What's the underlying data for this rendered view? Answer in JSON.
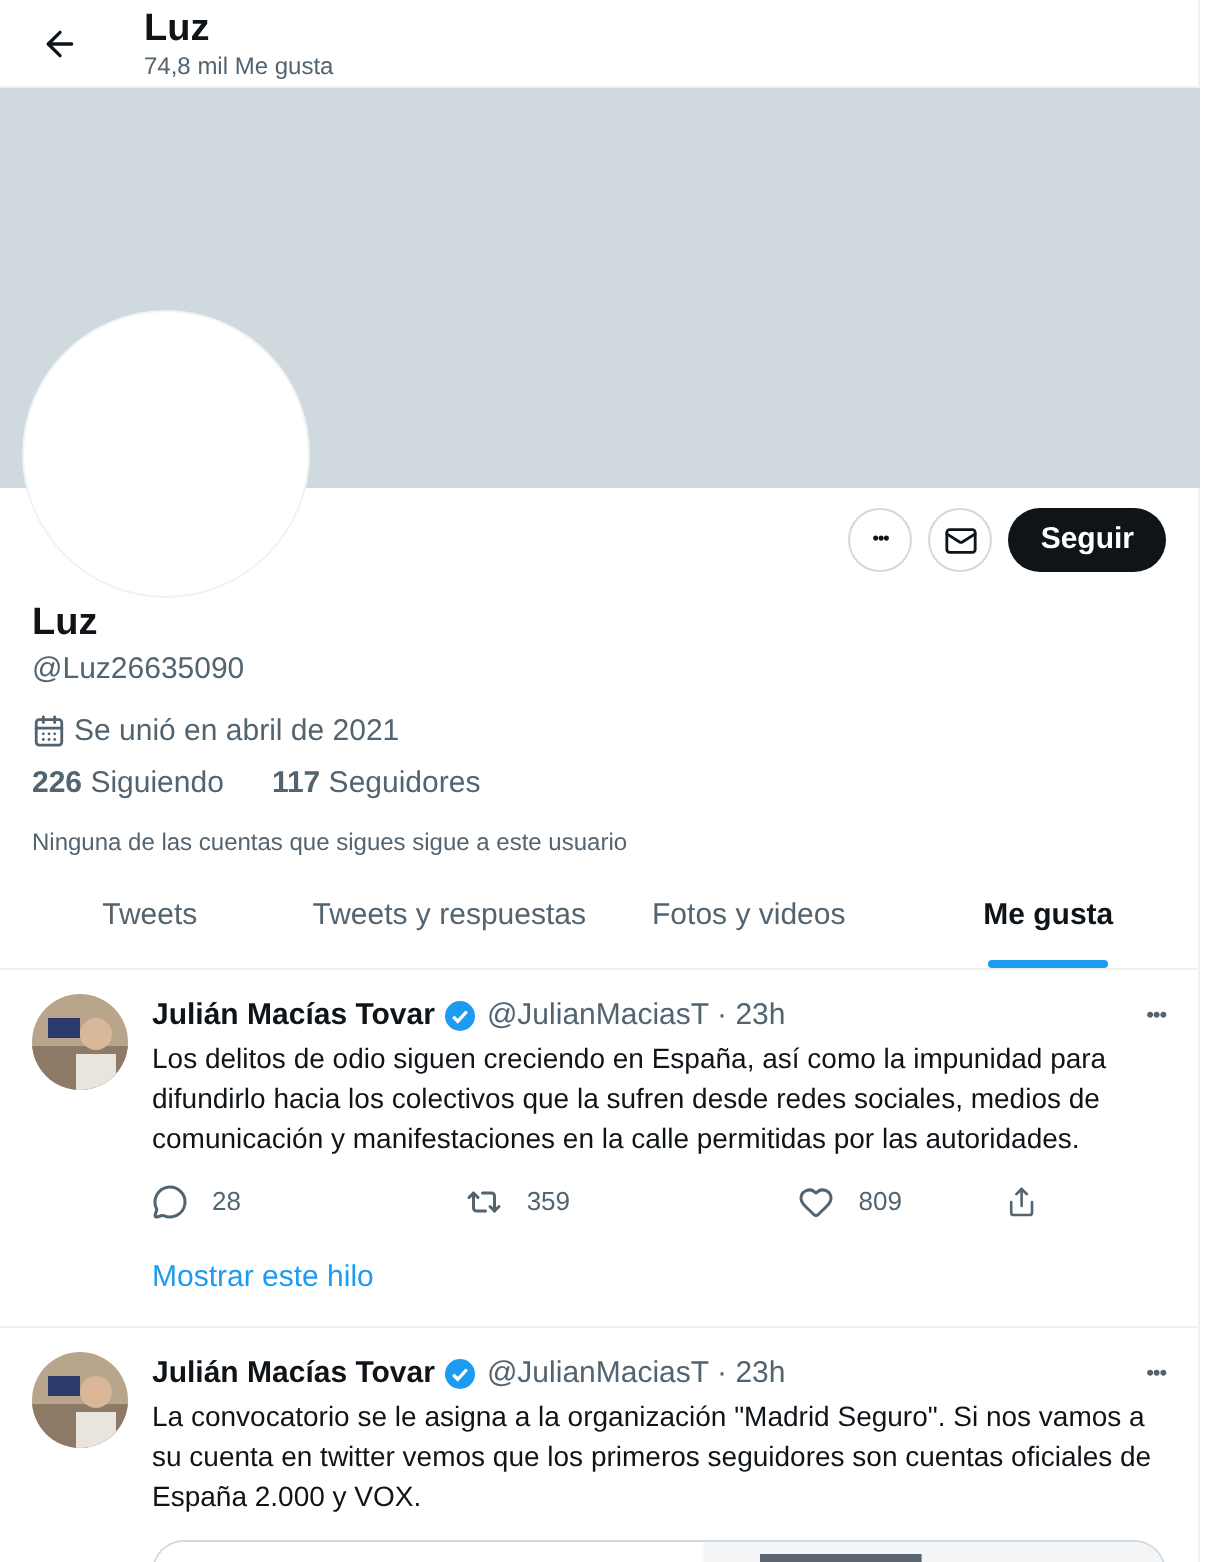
{
  "header": {
    "title": "Luz",
    "subtitle": "74,8 mil Me gusta"
  },
  "profile": {
    "more_button": "•••",
    "follow_button": "Seguir",
    "name": "Luz",
    "handle": "@Luz26635090",
    "joined": "Se unió en abril de 2021",
    "stats": [
      "**226** Siguiendo",
      "**117** Seguidores"
    ],
    "note": "Ninguna de las cuentas que sigues sigue a este usuario"
  },
  "tabs": [
    {
      "label": "Tweets",
      "selected": false
    },
    {
      "label": "Tweets y respuestas",
      "selected": false
    },
    {
      "label": "Fotos y videos",
      "selected": false
    },
    {
      "label": "Me gusta",
      "selected": true
    }
  ],
  "tweets": [
    {
      "author": "Julián Macías Tovar",
      "verified": true,
      "handle": "@JulianMaciasT",
      "time": "· 23h",
      "more": "•••",
      "text": "Los delitos de odio siguen creciendo en España, así como la impunidad para difundirlo hacia los colectivos que la sufren desde redes sociales, medios de comunicación y manifestaciones en la calle permitidas por las autoridades.",
      "replies": "28",
      "retweets": "359",
      "likes": "809",
      "thread_link": "Mostrar este hilo"
    },
    {
      "author": "Julián Macías Tovar",
      "verified": true,
      "handle": "@JulianMaciasT",
      "time": "· 23h",
      "more": "•••",
      "text": "La convocatorio se le asigna a la organización \"Madrid Seguro\". Si nos vamos a su cuenta en twitter vemos que los primeros seguidores son cuentas oficiales de España 2.000 y VOX."
    }
  ]
}
